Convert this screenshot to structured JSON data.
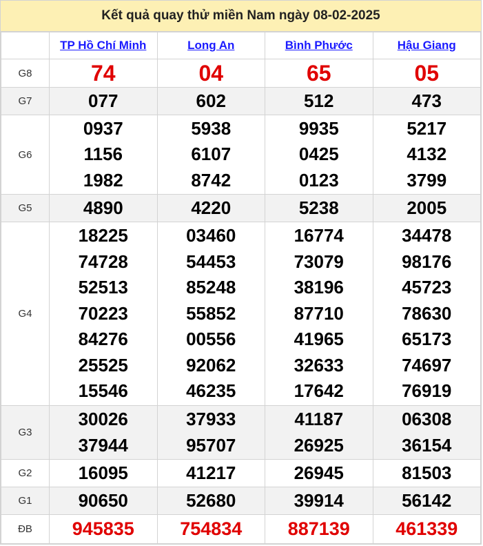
{
  "title": "Kết quả quay thử miền Nam ngày 08-02-2025",
  "provinces": [
    "TP Hồ Chí Minh",
    "Long An",
    "Bình Phước",
    "Hậu Giang"
  ],
  "colors": {
    "header_bg": "#fdf0b4",
    "link": "#1a1aff",
    "red": "#e00000",
    "alt_row": "#f2f2f2"
  },
  "rows": [
    {
      "label": "G8",
      "values": [
        [
          "74"
        ],
        [
          "04"
        ],
        [
          "65"
        ],
        [
          "05"
        ]
      ]
    },
    {
      "label": "G7",
      "values": [
        [
          "077"
        ],
        [
          "602"
        ],
        [
          "512"
        ],
        [
          "473"
        ]
      ]
    },
    {
      "label": "G6",
      "values": [
        [
          "0937",
          "1156",
          "1982"
        ],
        [
          "5938",
          "6107",
          "8742"
        ],
        [
          "9935",
          "0425",
          "0123"
        ],
        [
          "5217",
          "4132",
          "3799"
        ]
      ]
    },
    {
      "label": "G5",
      "values": [
        [
          "4890"
        ],
        [
          "4220"
        ],
        [
          "5238"
        ],
        [
          "2005"
        ]
      ]
    },
    {
      "label": "G4",
      "values": [
        [
          "18225",
          "74728",
          "52513",
          "70223",
          "84276",
          "25525",
          "15546"
        ],
        [
          "03460",
          "54453",
          "85248",
          "55852",
          "00556",
          "92062",
          "46235"
        ],
        [
          "16774",
          "73079",
          "38196",
          "87710",
          "41965",
          "32633",
          "17642"
        ],
        [
          "34478",
          "98176",
          "45723",
          "78630",
          "65173",
          "74697",
          "76919"
        ]
      ]
    },
    {
      "label": "G3",
      "values": [
        [
          "30026",
          "37944"
        ],
        [
          "37933",
          "95707"
        ],
        [
          "41187",
          "26925"
        ],
        [
          "06308",
          "36154"
        ]
      ]
    },
    {
      "label": "G2",
      "values": [
        [
          "16095"
        ],
        [
          "41217"
        ],
        [
          "26945"
        ],
        [
          "81503"
        ]
      ]
    },
    {
      "label": "G1",
      "values": [
        [
          "90650"
        ],
        [
          "52680"
        ],
        [
          "39914"
        ],
        [
          "56142"
        ]
      ]
    },
    {
      "label": "ĐB",
      "values": [
        [
          "945835"
        ],
        [
          "754834"
        ],
        [
          "887139"
        ],
        [
          "461339"
        ]
      ]
    }
  ]
}
